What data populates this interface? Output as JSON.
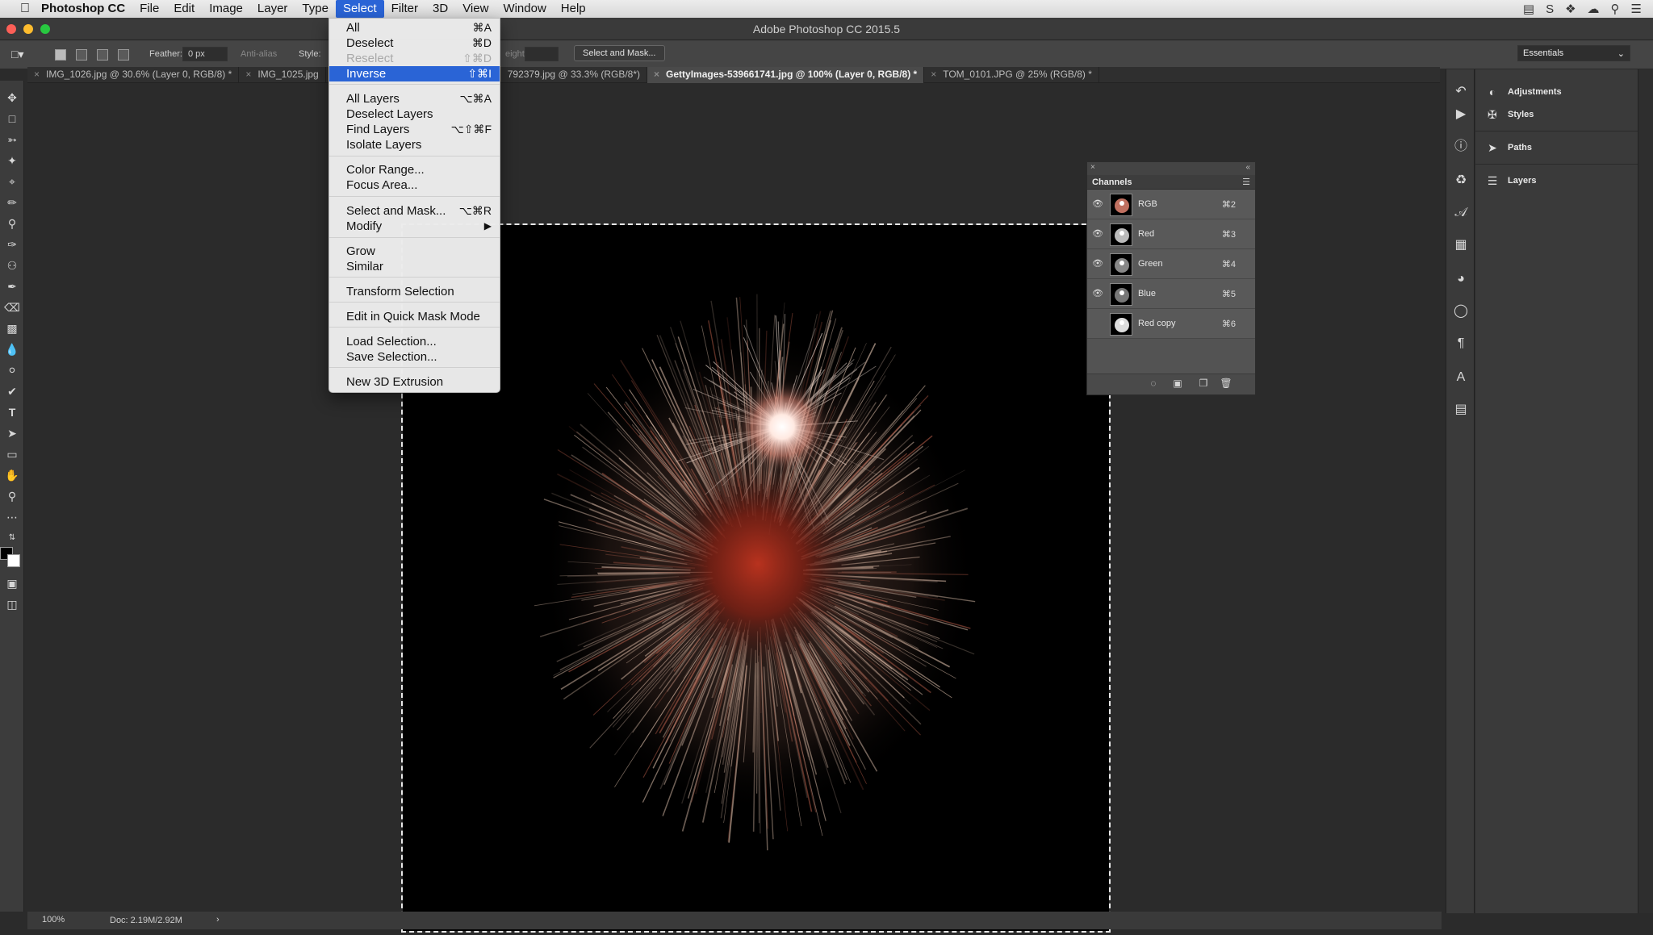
{
  "menubar": {
    "app": "Photoshop CC",
    "items": [
      "File",
      "Edit",
      "Image",
      "Layer",
      "Type",
      "Select",
      "Filter",
      "3D",
      "View",
      "Window",
      "Help"
    ],
    "active": "Select"
  },
  "window": {
    "title": "Adobe Photoshop CC 2015.5"
  },
  "options_bar": {
    "feather_label": "Feather:",
    "feather_value": "0 px",
    "antialias_label": "Anti-alias",
    "style_label": "Style:",
    "height_label": "eight:",
    "select_mask_button": "Select and Mask...",
    "workspace": "Essentials"
  },
  "tabs": [
    {
      "label": "IMG_1026.jpg @ 30.6% (Layer 0, RGB/8) *",
      "active": false
    },
    {
      "label": "IMG_1025.jpg",
      "active": false
    },
    {
      "label": "792379.jpg @ 33.3% (RGB/8*)",
      "active": false
    },
    {
      "label": "GettyImages-539661741.jpg @ 100% (Layer 0, RGB/8) *",
      "active": true
    },
    {
      "label": "TOM_0101.JPG @ 25% (RGB/8) *",
      "active": false
    }
  ],
  "select_menu": {
    "all": {
      "label": "All",
      "shortcut": "⌘A"
    },
    "deselect": {
      "label": "Deselect",
      "shortcut": "⌘D"
    },
    "reselect": {
      "label": "Reselect",
      "shortcut": "⇧⌘D"
    },
    "inverse": {
      "label": "Inverse",
      "shortcut": "⇧⌘I"
    },
    "all_layers": {
      "label": "All Layers",
      "shortcut": "⌥⌘A"
    },
    "deselect_layers": {
      "label": "Deselect Layers",
      "shortcut": ""
    },
    "find_layers": {
      "label": "Find Layers",
      "shortcut": "⌥⇧⌘F"
    },
    "isolate_layers": {
      "label": "Isolate Layers",
      "shortcut": ""
    },
    "color_range": {
      "label": "Color Range...",
      "shortcut": ""
    },
    "focus_area": {
      "label": "Focus Area...",
      "shortcut": ""
    },
    "select_and_mask": {
      "label": "Select and Mask...",
      "shortcut": "⌥⌘R"
    },
    "modify": {
      "label": "Modify",
      "shortcut": ""
    },
    "grow": {
      "label": "Grow",
      "shortcut": ""
    },
    "similar": {
      "label": "Similar",
      "shortcut": ""
    },
    "transform_selection": {
      "label": "Transform Selection",
      "shortcut": ""
    },
    "quick_mask": {
      "label": "Edit in Quick Mask Mode",
      "shortcut": ""
    },
    "load_selection": {
      "label": "Load Selection...",
      "shortcut": ""
    },
    "save_selection": {
      "label": "Save Selection...",
      "shortcut": ""
    },
    "new_3d_extrusion": {
      "label": "New 3D Extrusion",
      "shortcut": ""
    }
  },
  "channels_panel": {
    "title": "Channels",
    "channels": [
      {
        "name": "RGB",
        "shortcut": "⌘2"
      },
      {
        "name": "Red",
        "shortcut": "⌘3"
      },
      {
        "name": "Green",
        "shortcut": "⌘4"
      },
      {
        "name": "Blue",
        "shortcut": "⌘5"
      },
      {
        "name": "Red copy",
        "shortcut": "⌘6"
      }
    ]
  },
  "right_panel": {
    "adjustments": "Adjustments",
    "styles": "Styles",
    "paths": "Paths",
    "layers": "Layers"
  },
  "status": {
    "zoom": "100%",
    "doc": "Doc: 2.19M/2.92M"
  },
  "colors": {
    "accent": "#2a64d6",
    "background": "#2b2b2b",
    "panel": "#535353"
  }
}
